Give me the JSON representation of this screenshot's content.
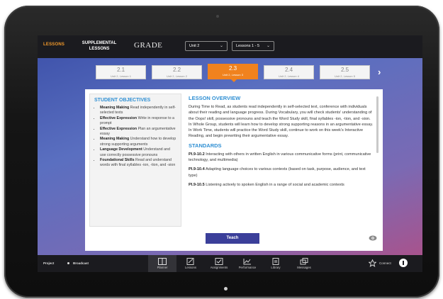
{
  "topbar": {
    "lessons_tab": "LESSONS",
    "supplemental_tab": "SUPPLEMENTAL LESSONS",
    "logo": "GRADE",
    "unit_select": "Unit 2",
    "lessons_select": "Lessons 1 - 5"
  },
  "lesson_tabs": [
    {
      "num": "2.1",
      "sub": "Unit 2, Lesson 1"
    },
    {
      "num": "2.2",
      "sub": "Unit 2, Lesson 2"
    },
    {
      "num": "2.3",
      "sub": "Unit 2, Lesson 3"
    },
    {
      "num": "2.4",
      "sub": "Unit 2, Lesson 4"
    },
    {
      "num": "2.5",
      "sub": "Unit 2, Lesson 5"
    }
  ],
  "objectives": {
    "title": "STUDENT OBJECTIVES",
    "items": [
      {
        "label": "Meaning Making",
        "text": " Read independently in self-selected texts"
      },
      {
        "label": "Effective Expression",
        "text": " Write in response to a prompt"
      },
      {
        "label": "Effective Expression",
        "text": " Plan an argumentative essay"
      },
      {
        "label": "Meaning Making",
        "text": " Understand how to develop strong supporting arguments"
      },
      {
        "label": "Language Development",
        "text": " Understand and use correctly possessive pronouns"
      },
      {
        "label": "Foundational Skills",
        "text": " Read and understand words with final syllables -ion, -tion, and -sion"
      }
    ]
  },
  "overview": {
    "title": "LESSON OVERVIEW",
    "text": "During Time to Read, as students read independently in self-selected text, conference with individuals about their reading and language progress. During Vocabulary, you will check students' understanding of the Oops! skill, possessive pronouns and teach the Word Study skill, final syllables -ion, -tion, and -sion. In Whole Group, students will learn how to develop strong supporting reasons in an argumentative essay. In Work Time, students will practice the Word Study skill, continue to work on this week's Interactive Reading, and begin prewriting their argumentative essay."
  },
  "standards": {
    "title": "STANDARDS",
    "items": [
      {
        "code": "PI.9-10.2",
        "text": " Interacting with others in written English in various communicative forms (print, communicative technology, and multimedia)"
      },
      {
        "code": "PI.9-10.4",
        "text": " Adapting language choices to various contexts (based on task, purpose, audience, and text type)"
      },
      {
        "code": "PI.9-10.5",
        "text": " Listening actively to spoken English in a range of social and academic contexts"
      }
    ]
  },
  "teach_button": "Teach",
  "bottombar": {
    "project": "Project",
    "broadcast": "Broadcast",
    "nav": [
      {
        "label": "Planner",
        "icon": "planner-icon"
      },
      {
        "label": "Lessons",
        "icon": "lessons-icon"
      },
      {
        "label": "Assignments",
        "icon": "assignments-icon"
      },
      {
        "label": "Performance",
        "icon": "performance-icon"
      },
      {
        "label": "Library",
        "icon": "library-icon"
      },
      {
        "label": "Messages",
        "icon": "messages-icon"
      }
    ],
    "connect": "Connect"
  },
  "colors": {
    "accent_orange": "#f0821e",
    "heading_blue": "#2f8fd3",
    "button_indigo": "#3b3f9a"
  }
}
